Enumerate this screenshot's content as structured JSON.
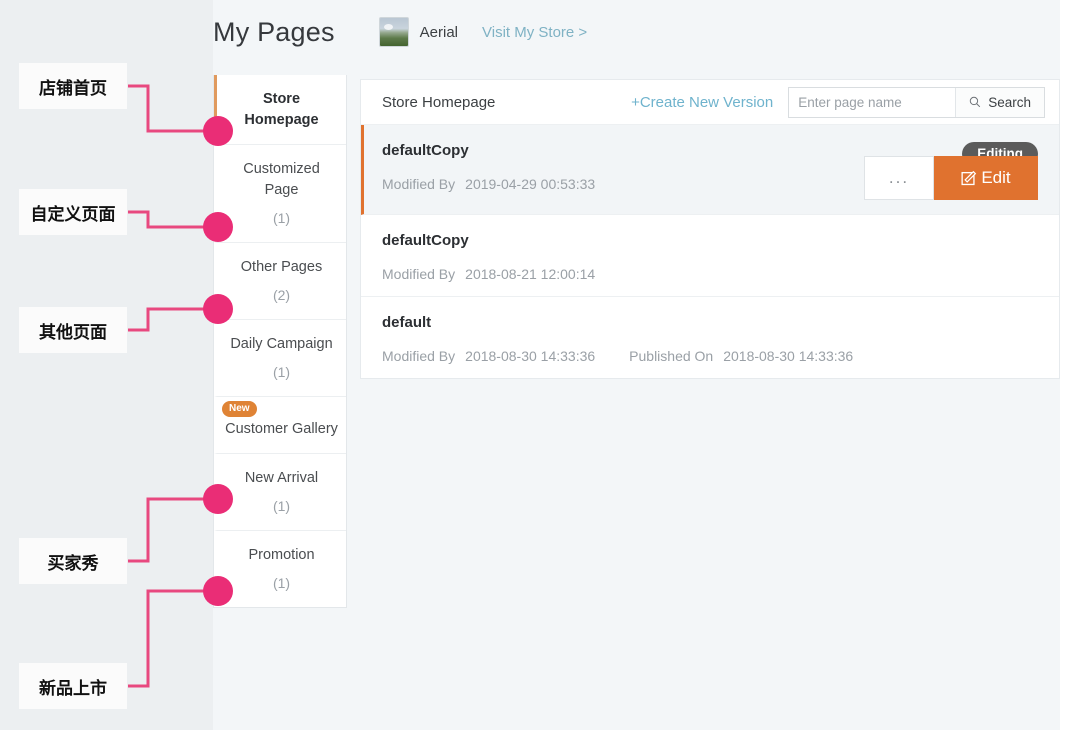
{
  "header": {
    "page_title": "My Pages",
    "store_name": "Aerial",
    "store_thumb_icon": "landscape-thumbnail",
    "visit_link": "Visit My Store >"
  },
  "sidebar": {
    "items": [
      {
        "label": "Store Homepage",
        "count": "",
        "badge": "",
        "active": true
      },
      {
        "label": "Customized Page",
        "count": "(1)",
        "badge": "",
        "active": false
      },
      {
        "label": "Other Pages",
        "count": "(2)",
        "badge": "",
        "active": false
      },
      {
        "label": "Daily Campaign",
        "count": "(1)",
        "badge": "",
        "active": false
      },
      {
        "label": "Customer Gallery",
        "count": "",
        "badge": "New",
        "active": false
      },
      {
        "label": "New Arrival",
        "count": "(1)",
        "badge": "",
        "active": false
      },
      {
        "label": "Promotion",
        "count": "(1)",
        "badge": "",
        "active": false
      }
    ]
  },
  "content": {
    "title": "Store Homepage",
    "create_link": "+Create New Version",
    "search": {
      "placeholder": "Enter page name",
      "value": "",
      "button_label": "Search",
      "button_icon": "search-icon"
    },
    "versions": [
      {
        "name": "defaultCopy",
        "modified_label": "Modified By",
        "modified_value": "2019-04-29 00:53:33",
        "published_label": "",
        "published_value": "",
        "status_badge": "Editing",
        "more_label": "...",
        "edit_label": "Edit",
        "edit_icon": "pencil-square-icon",
        "current": true
      },
      {
        "name": "defaultCopy",
        "modified_label": "Modified By",
        "modified_value": "2018-08-21 12:00:14",
        "published_label": "",
        "published_value": "",
        "status_badge": "",
        "more_label": "",
        "edit_label": "",
        "edit_icon": "",
        "current": false
      },
      {
        "name": "default",
        "modified_label": "Modified By",
        "modified_value": "2018-08-30 14:33:36",
        "published_label": "Published On",
        "published_value": "2018-08-30 14:33:36",
        "status_badge": "",
        "more_label": "",
        "edit_label": "",
        "edit_icon": "",
        "current": false
      }
    ]
  },
  "annotations": {
    "accent_color": "#ea2d76",
    "items": [
      {
        "label": "店铺首页"
      },
      {
        "label": "自定义页面"
      },
      {
        "label": "其他页面"
      },
      {
        "label": "买家秀"
      },
      {
        "label": "新品上市"
      }
    ]
  }
}
